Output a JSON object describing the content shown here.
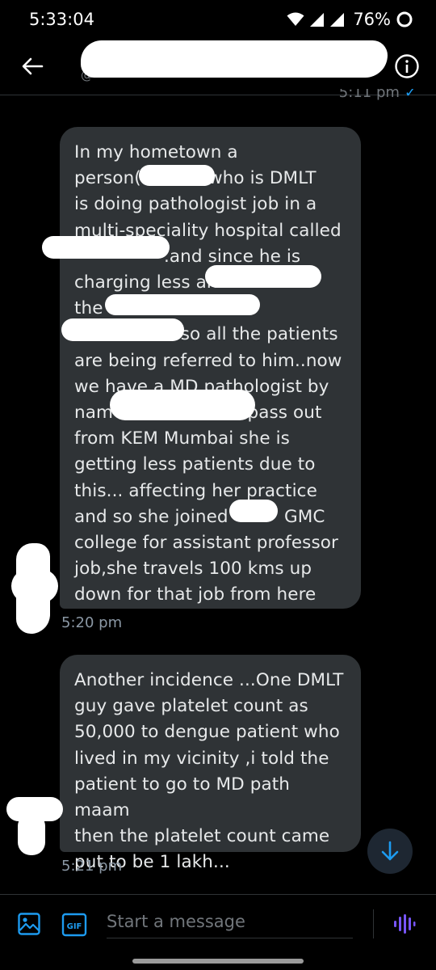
{
  "status_bar": {
    "time": "5:33:04",
    "battery": "76%"
  },
  "header": {
    "handle_fragment": "@",
    "previous_timestamp": "5:11 pm"
  },
  "messages": [
    {
      "lines": [
        "In my hometown a",
        "person(            who is DMLT",
        "is doing pathologist job in a",
        "multi-speciality hospital called",
        "                .and since he is",
        "charging less an",
        "the h",
        "                   so all the patients",
        "are being referred to him..now",
        "we have a MD pathologist by",
        "nam                        pass out",
        "from KEM Mumbai she is",
        "getting less patients due to",
        "this... affecting her practice",
        "and so she joined          GMC",
        "college for assistant professor",
        "job,she travels 100 kms up",
        "down for that job from here"
      ],
      "time": "5:20 pm"
    },
    {
      "lines": [
        "Another incidence ...One DMLT",
        "guy gave platelet count as",
        "50,000 to dengue patient who",
        "lived in my vicinity ,i told the",
        "patient to go to MD path maam",
        "then the platelet count came",
        "put to be 1 lakh..."
      ],
      "time": "5:21 pm"
    }
  ],
  "composer": {
    "placeholder": "Start a message",
    "gif_label": "GIF"
  },
  "icons": {
    "back": "arrow-left-icon",
    "info": "info-icon",
    "scroll_down": "arrow-down-icon",
    "image": "image-icon",
    "voice": "voice-waveform-icon"
  },
  "colors": {
    "background": "#000000",
    "bubble": "#2f3336",
    "accent": "#1d9bf0",
    "voice_accent": "#7856ff",
    "timestamp": "#8b98a5"
  }
}
